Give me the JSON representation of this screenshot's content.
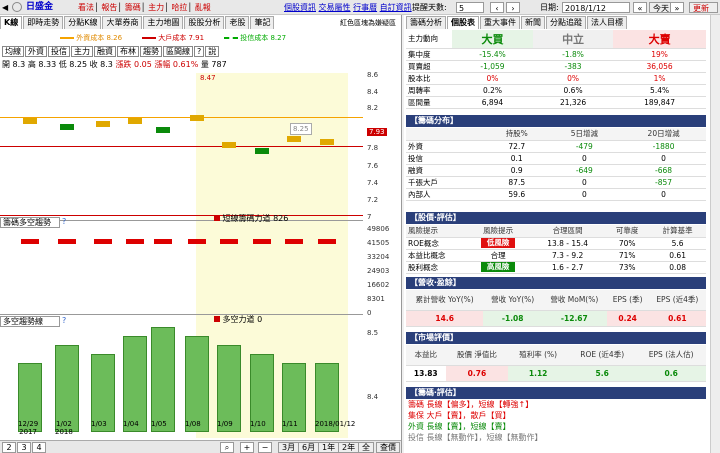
{
  "top": {
    "stock": "日盛金",
    "tabs": [
      "看法",
      "報告",
      "籌碼",
      "主力",
      "哈拉",
      "亂報"
    ],
    "links": [
      "個股資訊",
      "交易屬性",
      "行事曆",
      "自訂資訊"
    ],
    "count_label": "提醒天數:",
    "count_value": "5",
    "date_label": "日期:",
    "date_value": "2018/1/12",
    "today": "今天",
    "refresh": "更新"
  },
  "chart_tabs": [
    "K線",
    "即時走勢",
    "分點K線",
    "大單券商",
    "主力地圖",
    "股股分析",
    "老股",
    "筆記"
  ],
  "note": "紅色區塊為嫌疑區",
  "legend": {
    "main_cost": "外資成本 8.26",
    "big_cost": "大戶成本 7.91",
    "trust_cost": "投信成本 8.27"
  },
  "chips": [
    "均線",
    "外資",
    "投信",
    "主力",
    "融資",
    "布林",
    "趨勢",
    "區間線",
    "?",
    "說"
  ],
  "ohlc": {
    "open": "開 8.3",
    "high": "高 8.33",
    "low": "低 8.25",
    "close": "收 8.3",
    "chg_label": "漲跌",
    "chg": "0.05",
    "pct_label": "漲幅",
    "pct": "0.61%",
    "vol_label": "量",
    "vol": "787"
  },
  "chart_data": [
    {
      "type": "bar",
      "title": "",
      "candles": [
        8.37,
        8.35,
        8.36,
        8.37,
        8.34,
        8.38,
        8.29,
        8.27,
        8.31,
        8.3
      ],
      "lines": {
        "foreign_cost": 8.26,
        "big_cost": 7.91
      },
      "y_ticks": [
        "8.6",
        "8.4",
        "8.2",
        "7.93",
        "7.8",
        "7.6",
        "7.4",
        "7.2",
        "7"
      ],
      "tags": [
        "8.47",
        "8.25"
      ]
    },
    {
      "type": "bar",
      "title": "",
      "label": "短線籌碼力道 826",
      "y_ticks": [
        "49806",
        "41505",
        "33204",
        "24903",
        "16602",
        "8301",
        "0"
      ]
    },
    {
      "type": "bar",
      "title": "",
      "label": "多空力道 0",
      "values": [
        8.5,
        8.7,
        8.6,
        8.8,
        8.9,
        8.8,
        8.7,
        8.6,
        8.5,
        8.5
      ],
      "y_ticks": [
        "8.5",
        "8.4"
      ]
    }
  ],
  "panel_sel": [
    "籌碼多空趨勢",
    "多空趨勢線"
  ],
  "x_labels": [
    "12/29\n2017",
    "1/02\n2018",
    "1/03",
    "1/04",
    "1/05",
    "1/08",
    "1/09",
    "1/10",
    "1/11",
    "2018/01/12"
  ],
  "bottom": {
    "nums": [
      "2",
      "3",
      "4"
    ],
    "ranges": [
      "3月",
      "6月",
      "1年",
      "2年",
      "全"
    ],
    "end": "查價"
  },
  "rtabs": [
    "籌碼分析",
    "個股表",
    "重大事件",
    "新聞",
    "分點追蹤",
    "法人目標"
  ],
  "summary": {
    "heads": [
      "大買",
      "中立",
      "大賣"
    ],
    "rows": [
      [
        "主力動向",
        "大買",
        "中立",
        "大賣"
      ],
      [
        "集中度",
        "-15.4%",
        "-1.8%",
        "19%"
      ],
      [
        "買賣超",
        "-1,059",
        "-383",
        "36,056"
      ],
      [
        "股本比",
        "0%",
        "0%",
        "1%"
      ],
      [
        "周轉率",
        "0.2%",
        "0.6%",
        "5.4%"
      ],
      [
        "區間量",
        "6,894",
        "21,326",
        "189,847"
      ]
    ]
  },
  "dist": {
    "title": "【籌碼分布】",
    "head": [
      "持股%",
      "5日增減",
      "20日增減"
    ],
    "rows": [
      [
        "外資",
        "72.7",
        "-479",
        "-1880"
      ],
      [
        "投信",
        "0.1",
        "0",
        "0"
      ],
      [
        "融資",
        "0.9",
        "-649",
        "-668"
      ],
      [
        "千張大戶",
        "87.5",
        "0",
        "-857"
      ],
      [
        "內部人",
        "59.6",
        "0",
        "0"
      ]
    ]
  },
  "val": {
    "title": "【股價‧評估】",
    "head": [
      "風險提示",
      "合理區間",
      "可靠度",
      "計算基準"
    ],
    "rows": [
      [
        "ROE概念",
        "低風險",
        "13.8 - 15.4",
        "70%",
        "5.6"
      ],
      [
        "本益比概念",
        "合理",
        "7.3 - 9.2",
        "71%",
        "0.61"
      ],
      [
        "股利概念",
        "高風險",
        "1.6 - 2.7",
        "73%",
        "0.08"
      ]
    ]
  },
  "rev": {
    "title": "【營收‧盈餘】",
    "head": [
      "累計營收 YoY(%)",
      "營收 YoY(%)",
      "營收 MoM(%)",
      "EPS (季)",
      "EPS (近4季)"
    ],
    "vals": [
      "14.6",
      "-1.08",
      "-12.67",
      "0.24",
      "0.61"
    ]
  },
  "mkt": {
    "title": "【市場評價】",
    "head": [
      "本益比",
      "股價 淨值比",
      "殖利率 (%)",
      "ROE (近4季)",
      "EPS (法人估)"
    ],
    "vals": [
      "13.83",
      "0.76",
      "1.12",
      "5.6",
      "0.6"
    ]
  },
  "eval2": {
    "title": "【籌碼‧評估】",
    "lines": [
      "籌碼 長線【偏多】，短線【轉強↑】",
      "集保 大戶【賣】，散戶【買】",
      "外資 長線【賣】，短線【賣】",
      "投信 長線【無動作】，短線【無動作】"
    ]
  }
}
